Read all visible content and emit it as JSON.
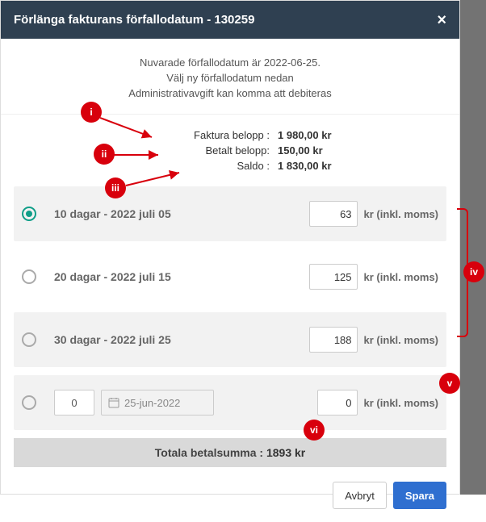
{
  "titlebar": {
    "text": "Förlänga fakturans förfallodatum - 130259"
  },
  "intro": {
    "line1": "Nuvarade förfallodatum är 2022-06-25.",
    "line2": "Välj ny förfallodatum nedan",
    "line3": "Administrativavgift kan komma att debiteras"
  },
  "amounts": {
    "invoice_label": "Faktura belopp :",
    "invoice_value": "1 980,00 kr",
    "paid_label": "Betalt belopp:",
    "paid_value": "150,00 kr",
    "balance_label": "Saldo :",
    "balance_value": "1 830,00 kr"
  },
  "options": {
    "suffix": "kr (inkl. moms)",
    "o1": {
      "label": "10 dagar - 2022 juli 05",
      "value": "63"
    },
    "o2": {
      "label": "20 dagar - 2022 juli 15",
      "value": "125"
    },
    "o3": {
      "label": "30 dagar - 2022 juli 25",
      "value": "188"
    },
    "custom": {
      "days": "0",
      "date": "25-jun-2022",
      "value": "0"
    }
  },
  "total": {
    "label": "Totala betalsumma :",
    "value": "1893 kr"
  },
  "buttons": {
    "cancel": "Avbryt",
    "save": "Spara"
  },
  "badges": {
    "i": "i",
    "ii": "ii",
    "iii": "iii",
    "iv": "iv",
    "v": "v",
    "vi": "vi"
  }
}
